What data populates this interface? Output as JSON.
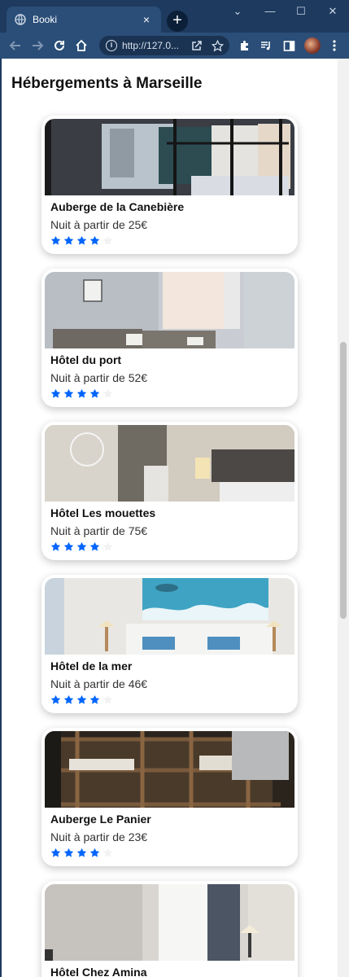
{
  "browser": {
    "tab_title": "Booki",
    "tab_close": "×",
    "new_tab": "+",
    "url": "http://127.0...",
    "win_minimize": "⌄",
    "win_min": "—",
    "win_max": "☐",
    "win_close": "✕"
  },
  "page": {
    "heading": "Hébergements à Marseille"
  },
  "colors": {
    "star_filled": "#0065fc",
    "star_empty": "#f2f2f2"
  },
  "cards": [
    {
      "name": "Auberge de la Canebière",
      "price": "Nuit à partir de 25€",
      "rating": 4,
      "max_rating": 5
    },
    {
      "name": "Hôtel du port",
      "price": "Nuit à partir de 52€",
      "rating": 4,
      "max_rating": 5
    },
    {
      "name": "Hôtel Les mouettes",
      "price": "Nuit à partir de 75€",
      "rating": 4,
      "max_rating": 5
    },
    {
      "name": "Hôtel de la mer",
      "price": "Nuit à partir de 46€",
      "rating": 4,
      "max_rating": 5
    },
    {
      "name": "Auberge Le Panier",
      "price": "Nuit à partir de 23€",
      "rating": 4,
      "max_rating": 5
    },
    {
      "name": "Hôtel Chez Amina",
      "price": "",
      "rating": 0,
      "max_rating": 5
    }
  ]
}
